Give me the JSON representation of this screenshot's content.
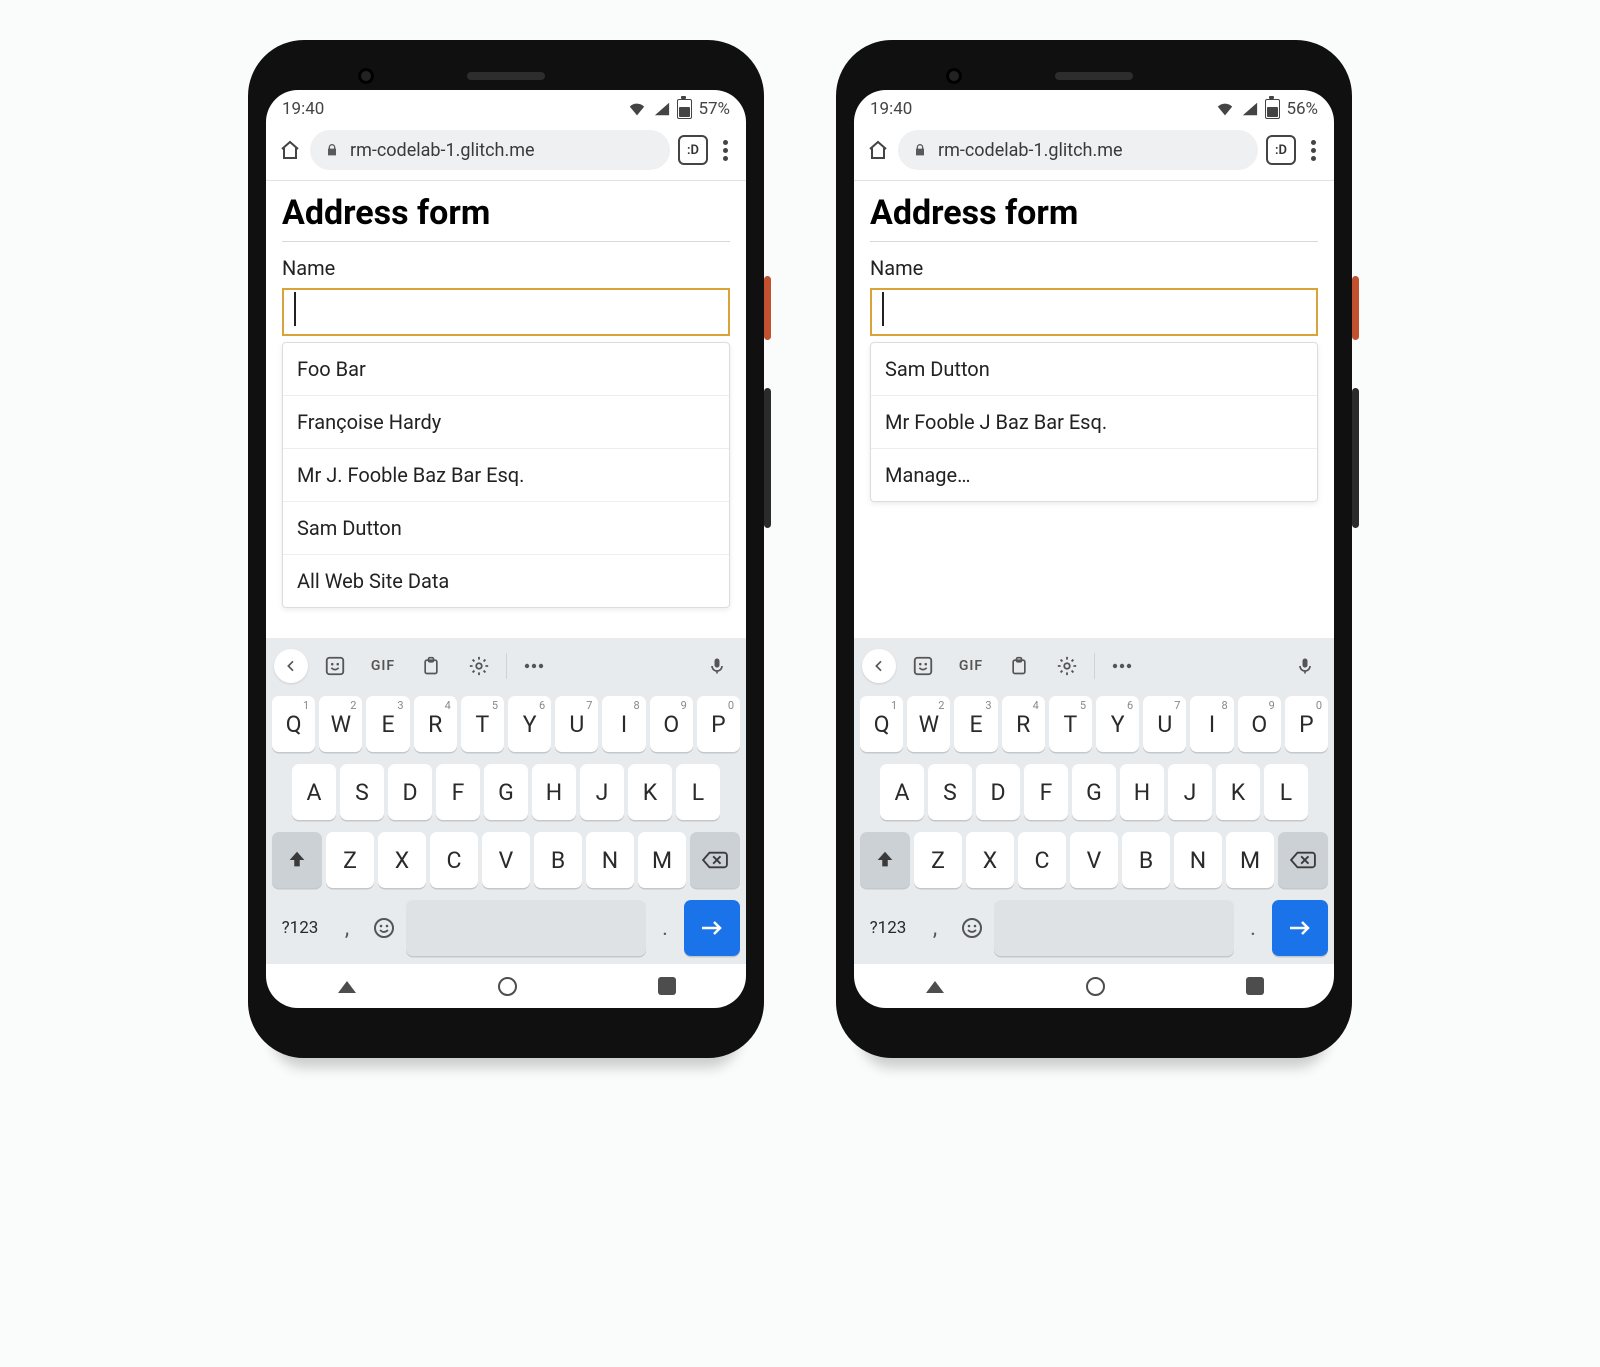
{
  "phones": [
    {
      "status": {
        "time": "19:40",
        "battery_pct": "57%",
        "battery_fill": 57
      },
      "browser": {
        "url": "rm-codelab-1.glitch.me",
        "tab_count": ":D"
      },
      "page": {
        "heading": "Address form",
        "name_label": "Name",
        "name_value": ""
      },
      "suggestions": [
        "Foo Bar",
        "Françoise Hardy",
        "Mr J. Fooble Baz Bar Esq.",
        "Sam Dutton",
        "All Web Site Data"
      ]
    },
    {
      "status": {
        "time": "19:40",
        "battery_pct": "56%",
        "battery_fill": 56
      },
      "browser": {
        "url": "rm-codelab-1.glitch.me",
        "tab_count": ":D"
      },
      "page": {
        "heading": "Address form",
        "name_label": "Name",
        "name_value": ""
      },
      "suggestions": [
        "Sam Dutton",
        "Mr Fooble J Baz Bar Esq.",
        "Manage…"
      ]
    }
  ],
  "keyboard": {
    "row1": [
      {
        "k": "Q",
        "n": "1"
      },
      {
        "k": "W",
        "n": "2"
      },
      {
        "k": "E",
        "n": "3"
      },
      {
        "k": "R",
        "n": "4"
      },
      {
        "k": "T",
        "n": "5"
      },
      {
        "k": "Y",
        "n": "6"
      },
      {
        "k": "U",
        "n": "7"
      },
      {
        "k": "I",
        "n": "8"
      },
      {
        "k": "O",
        "n": "9"
      },
      {
        "k": "P",
        "n": "0"
      }
    ],
    "row2": [
      "A",
      "S",
      "D",
      "F",
      "G",
      "H",
      "J",
      "K",
      "L"
    ],
    "row3": [
      "Z",
      "X",
      "C",
      "V",
      "B",
      "N",
      "M"
    ],
    "sym": "?123",
    "comma": ",",
    "period": "."
  },
  "tools": {
    "gif": "GIF"
  }
}
